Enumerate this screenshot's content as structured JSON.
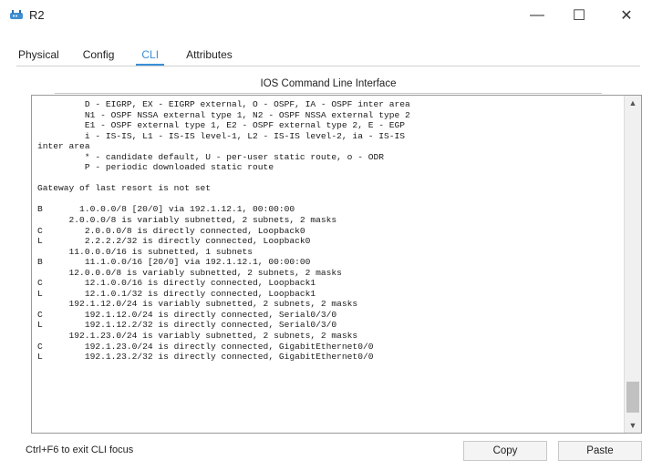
{
  "window": {
    "title": "R2",
    "minimize_glyph": "—",
    "maximize_glyph": "☐",
    "close_glyph": "✕"
  },
  "tabs": [
    {
      "label": "Physical"
    },
    {
      "label": "Config"
    },
    {
      "label": "CLI"
    },
    {
      "label": "Attributes"
    }
  ],
  "panel": {
    "title": "IOS Command Line Interface"
  },
  "terminal_lines": [
    "         D - EIGRP, EX - EIGRP external, O - OSPF, IA - OSPF inter area",
    "         N1 - OSPF NSSA external type 1, N2 - OSPF NSSA external type 2",
    "         E1 - OSPF external type 1, E2 - OSPF external type 2, E - EGP",
    "         i - IS-IS, L1 - IS-IS level-1, L2 - IS-IS level-2, ia - IS-IS",
    "inter area",
    "         * - candidate default, U - per-user static route, o - ODR",
    "         P - periodic downloaded static route",
    "",
    "Gateway of last resort is not set",
    "",
    "B       1.0.0.0/8 [20/0] via 192.1.12.1, 00:00:00",
    "      2.0.0.0/8 is variably subnetted, 2 subnets, 2 masks",
    "C        2.0.0.0/8 is directly connected, Loopback0",
    "L        2.2.2.2/32 is directly connected, Loopback0",
    "      11.0.0.0/16 is subnetted, 1 subnets",
    "B        11.1.0.0/16 [20/0] via 192.1.12.1, 00:00:00",
    "      12.0.0.0/8 is variably subnetted, 2 subnets, 2 masks",
    "C        12.1.0.0/16 is directly connected, Loopback1",
    "L        12.1.0.1/32 is directly connected, Loopback1",
    "      192.1.12.0/24 is variably subnetted, 2 subnets, 2 masks",
    "C        192.1.12.0/24 is directly connected, Serial0/3/0",
    "L        192.1.12.2/32 is directly connected, Serial0/3/0",
    "      192.1.23.0/24 is variably subnetted, 2 subnets, 2 masks",
    "C        192.1.23.0/24 is directly connected, GigabitEthernet0/0",
    "L        192.1.23.2/32 is directly connected, GigabitEthernet0/0"
  ],
  "scrollbar": {
    "up_glyph": "▲",
    "down_glyph": "▼"
  },
  "footer": {
    "status": "Ctrl+F6 to exit CLI focus",
    "copy_label": "Copy",
    "paste_label": "Paste"
  },
  "colors": {
    "accent": "#3a8fd8"
  }
}
